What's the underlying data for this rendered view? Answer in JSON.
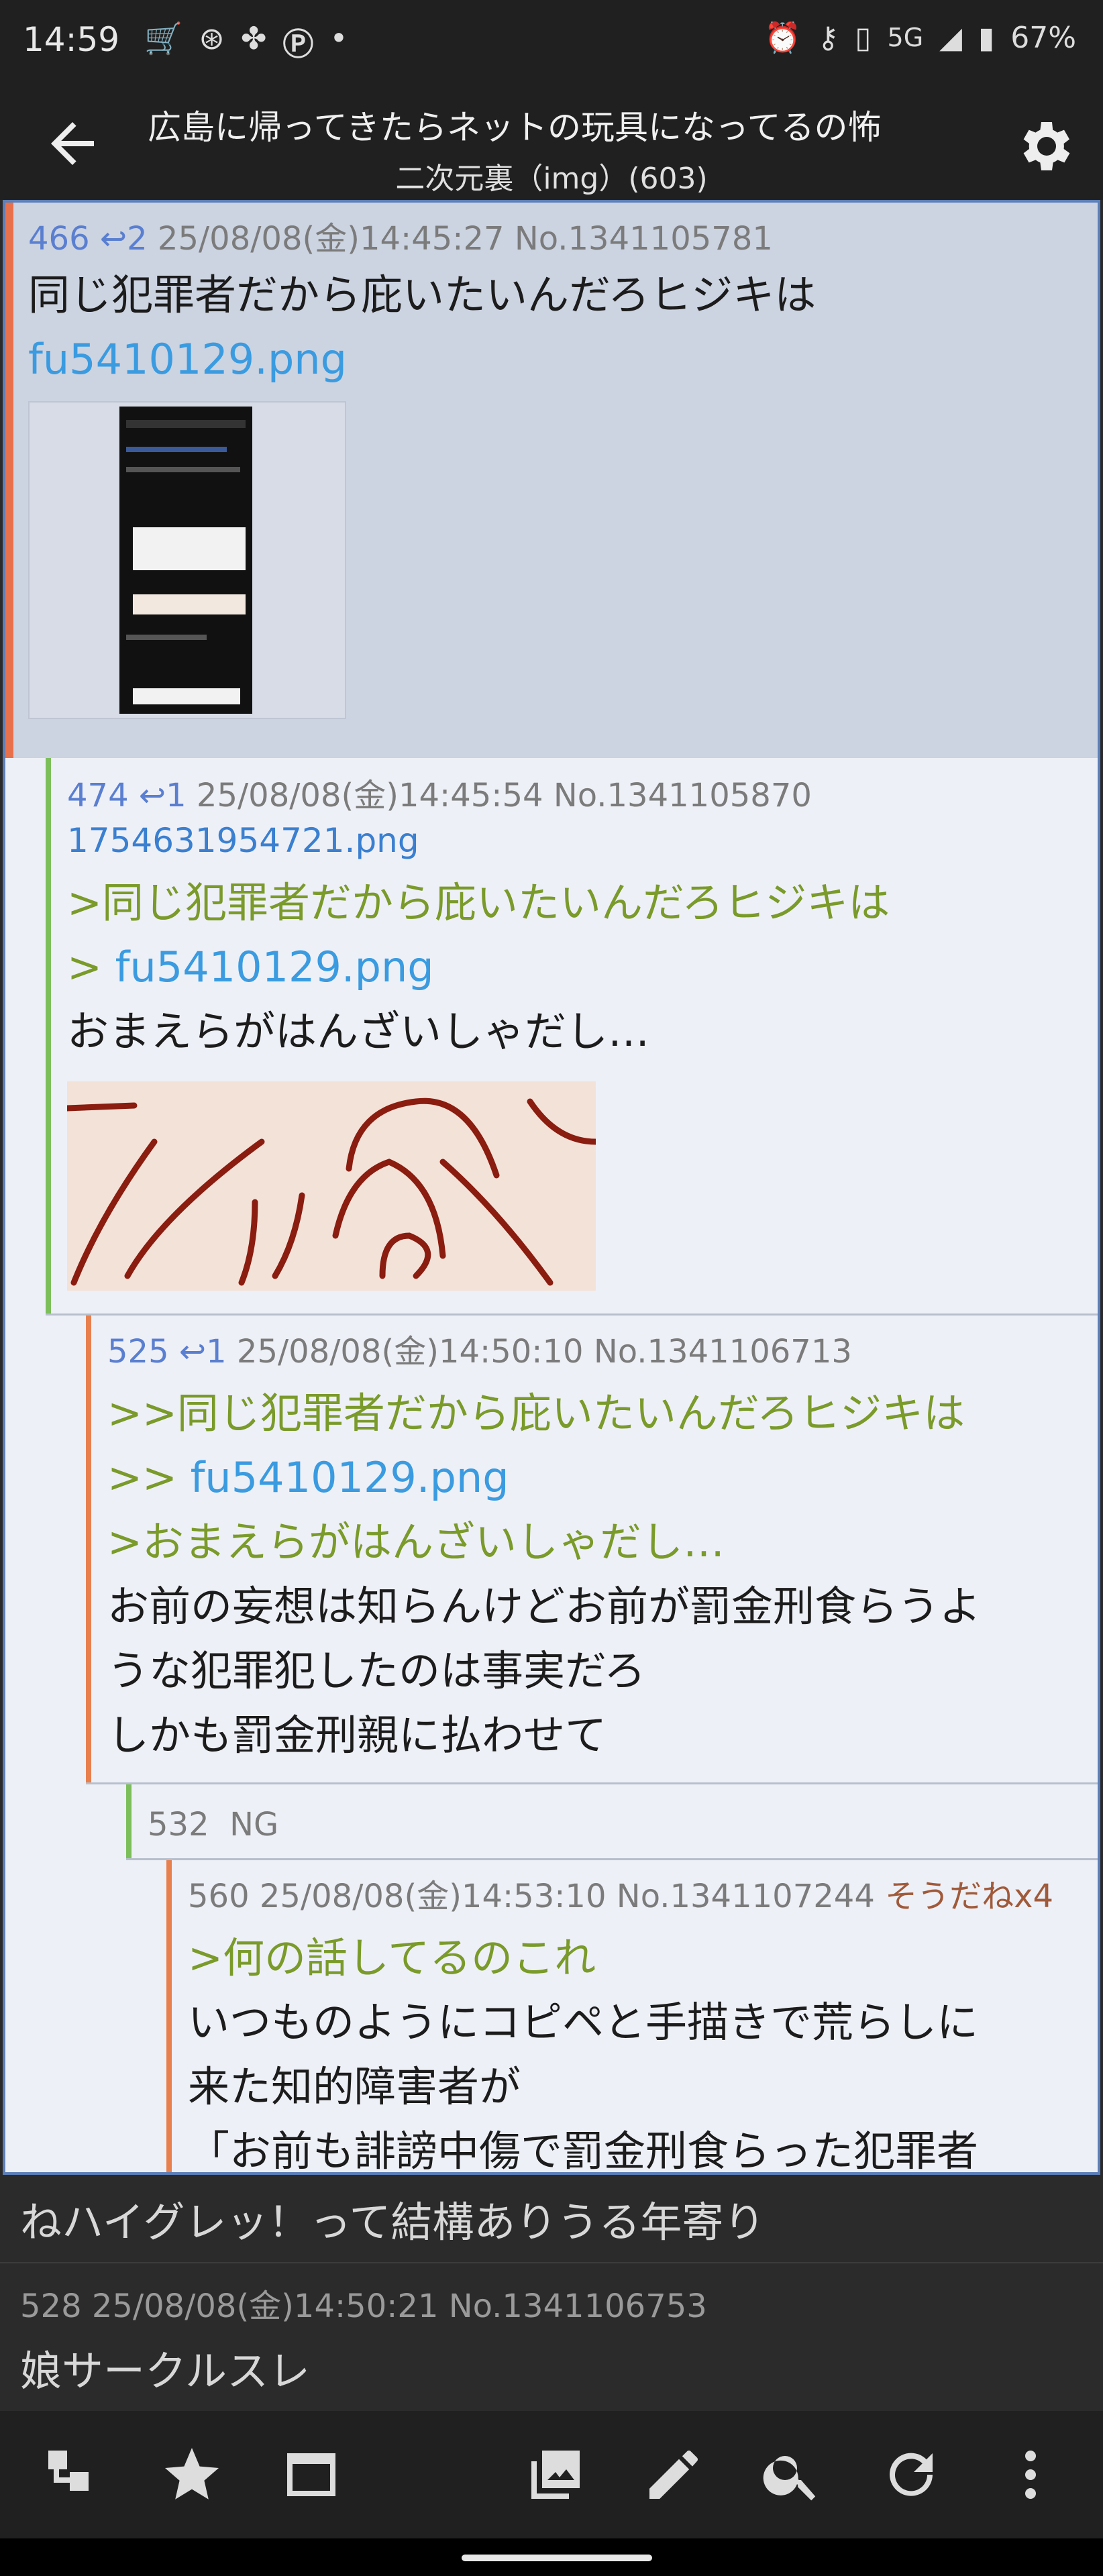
{
  "status_bar": {
    "time": "14:59",
    "network": "5G",
    "battery": "67%",
    "icons_left": [
      "cart-icon",
      "game-icon",
      "fan-icon",
      "p-app-icon",
      "dot-icon"
    ],
    "icons_right": [
      "alarm-icon",
      "key-icon",
      "vibrate-icon",
      "signal-icon",
      "battery-icon"
    ]
  },
  "app_bar": {
    "title": "広島に帰ってきたらネットの玩具になってるの怖",
    "subtitle": "二次元裏（img）(603)"
  },
  "posts": [
    {
      "num": "466",
      "replies": "2",
      "date": "25/08/08(金)14:45:27",
      "no": "No.1341105781",
      "lines": [
        "同じ犯罪者だから庇いたいんだろヒジキは"
      ],
      "file": "fu5410129.png"
    },
    {
      "num": "474",
      "replies": "1",
      "date": "25/08/08(金)14:45:54",
      "no": "No.1341105870",
      "filename": "1754631954721.png",
      "quote1": ">同じ犯罪者だから庇いたいんだろヒジキは",
      "quote2_prefix": "> ",
      "quote2_link": "fu5410129.png",
      "text": "おまえらがはんざいしゃだし…"
    },
    {
      "num": "525",
      "replies": "1",
      "date": "25/08/08(金)14:50:10",
      "no": "No.1341106713",
      "quote1": ">>同じ犯罪者だから庇いたいんだろヒジキは",
      "quote2_prefix": ">> ",
      "quote2_link": "fu5410129.png",
      "quote3": ">おまえらがはんざいしゃだし…",
      "lines": [
        "お前の妄想は知らんけどお前が罰金刑食らうよ",
        "うな犯罪犯したのは事実だろ",
        "しかも罰金刑親に払わせて"
      ]
    },
    {
      "num": "532",
      "ng": "NG"
    },
    {
      "num": "560",
      "date": "25/08/08(金)14:53:10",
      "no": "No.1341107244",
      "soudane": "そうだねx4",
      "quote1": ">何の話してるのこれ",
      "lines": [
        "いつものようにコピペと手描きで荒らしに",
        "来た知的障害者が",
        "「お前も誹謗中傷で罰金刑食らった犯罪者"
      ]
    }
  ],
  "below": {
    "text1": "ねハイグレッ！って結構ありうる年寄り",
    "meta2": "528 25/08/08(金)14:50:21 No.1341106753",
    "text2": "娘サークルスレ"
  },
  "bottom_nav": [
    "tree-icon",
    "star-icon",
    "window-icon",
    "gallery-icon",
    "edit-icon",
    "search-icon",
    "refresh-icon",
    "more-icon"
  ],
  "colors": {
    "quote": "#7a9a2a",
    "link": "#3a9be0",
    "highlight_bg": "#ccd3e1",
    "thread_border": "#5c7fb8",
    "orange_bar": "#e8804d",
    "green_bar": "#7cbf5a"
  }
}
